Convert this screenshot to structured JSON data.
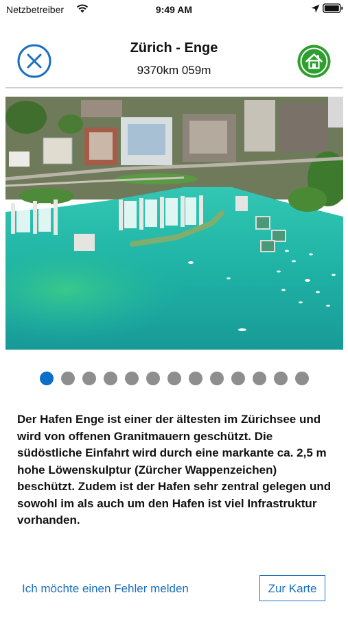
{
  "status_bar": {
    "carrier": "Netzbetreiber",
    "time": "9:49 AM",
    "icons": [
      "wifi-icon",
      "location-arrow-icon",
      "battery-icon"
    ]
  },
  "header": {
    "title": "Zürich - Enge",
    "distance": "9370km 059m",
    "close_icon": "close-circle-icon",
    "home_icon": "home-icon"
  },
  "gallery": {
    "image_subject": "Aerial view of Hafen Enge harbor on Lake Zurich",
    "page_count": 13,
    "current_page": 1
  },
  "description": {
    "text": "Der Hafen Enge ist einer der ältesten im Zürichsee und wird von offenen Granitmauern geschützt. Die südöstliche Einfahrt wird durch eine markante ca. 2,5 m hohe Löwenskulptur (Zürcher Wappenzeichen) beschützt. Zudem ist der Hafen sehr zentral gelegen und sowohl im als auch um den Hafen ist viel Infrastruktur vorhanden."
  },
  "actions": {
    "report_label": "Ich möchte einen Fehler melden",
    "map_label": "Zur Karte"
  },
  "colors": {
    "accent_blue": "#1a6fc0",
    "home_green": "#2e9e2e",
    "dot_inactive": "#8e8e8e",
    "dot_active": "#0b6ec8",
    "water": "#1fb8a8"
  }
}
